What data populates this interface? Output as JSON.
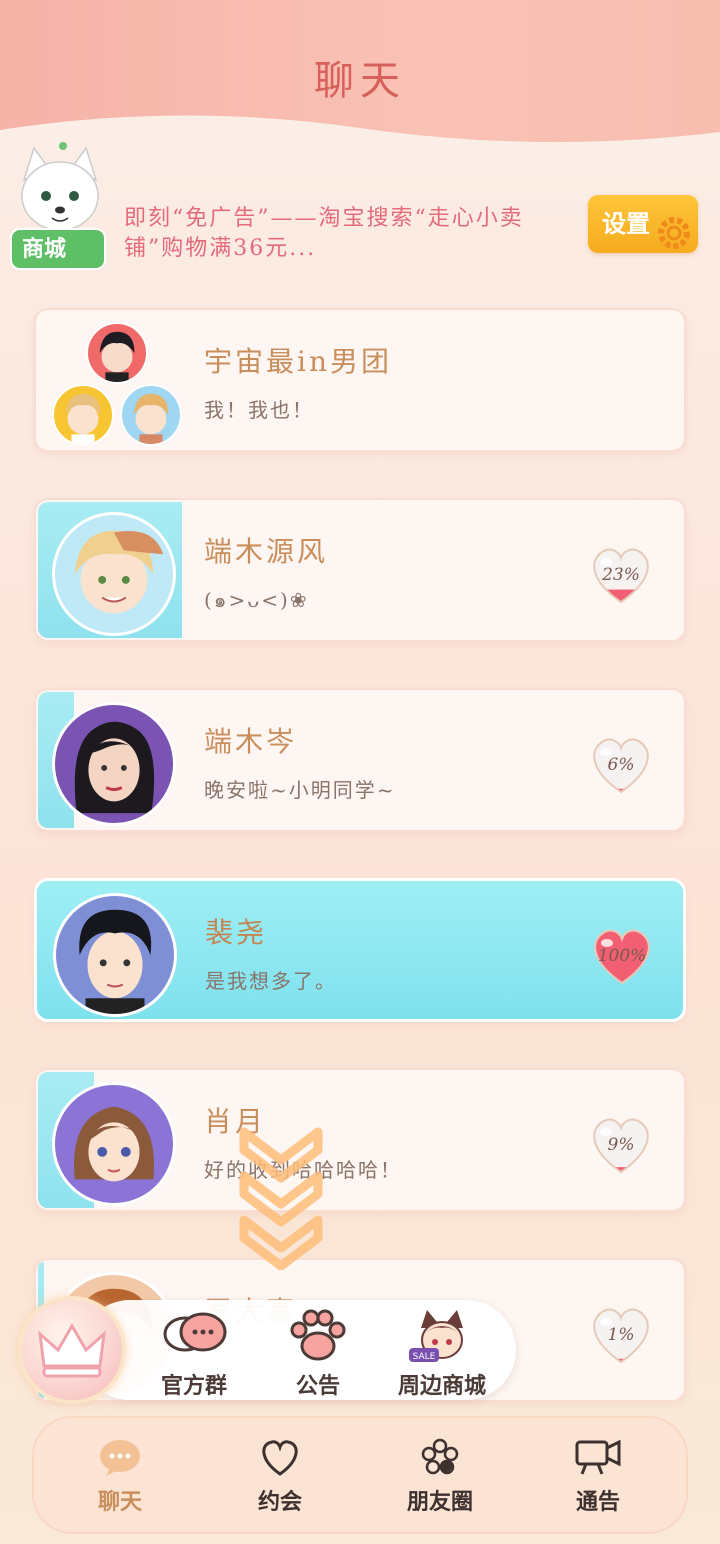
{
  "header": {
    "title": "聊天"
  },
  "shop_badge": {
    "label": "商城"
  },
  "notice": {
    "text": "即刻“免广告”——淘宝搜索“走心小卖铺”购物满36元..."
  },
  "settings": {
    "label": "设置"
  },
  "chats": [
    {
      "name": "宇宙最in男团",
      "message": "我！我也！",
      "affinity": "",
      "type": "group"
    },
    {
      "name": "端木源风",
      "message": "(๑>ᴗ<)❀",
      "affinity": "23%",
      "level": 0.23
    },
    {
      "name": "端木岑",
      "message": "晚安啦~小明同学~",
      "affinity": "6%",
      "level": 0.06
    },
    {
      "name": "裴尧",
      "message": "是我想多了。",
      "affinity": "100%",
      "level": 1.0,
      "active": true
    },
    {
      "name": "肖月",
      "message": "好的收到哈哈哈哈！",
      "affinity": "9%",
      "level": 0.09
    },
    {
      "name": "罗大喜",
      "message": "",
      "affinity": "1%",
      "level": 0.01
    }
  ],
  "quickbar": {
    "items": [
      {
        "label": "官方群",
        "icon": "chat-bubbles-icon"
      },
      {
        "label": "公告",
        "icon": "paw-icon"
      },
      {
        "label": "周边商城",
        "icon": "sale-cat-icon",
        "badge": "SALE"
      }
    ]
  },
  "tabs": [
    {
      "label": "聊天",
      "icon": "chat-icon",
      "active": true
    },
    {
      "label": "约会",
      "icon": "heart-outline-icon"
    },
    {
      "label": "朋友圈",
      "icon": "flower-icon"
    },
    {
      "label": "通告",
      "icon": "camera-icon"
    }
  ],
  "colors": {
    "accent": "#c98e5c",
    "header": "#f6b3a8",
    "active_card": "#8ee2ee",
    "heart": "#f25f73"
  }
}
